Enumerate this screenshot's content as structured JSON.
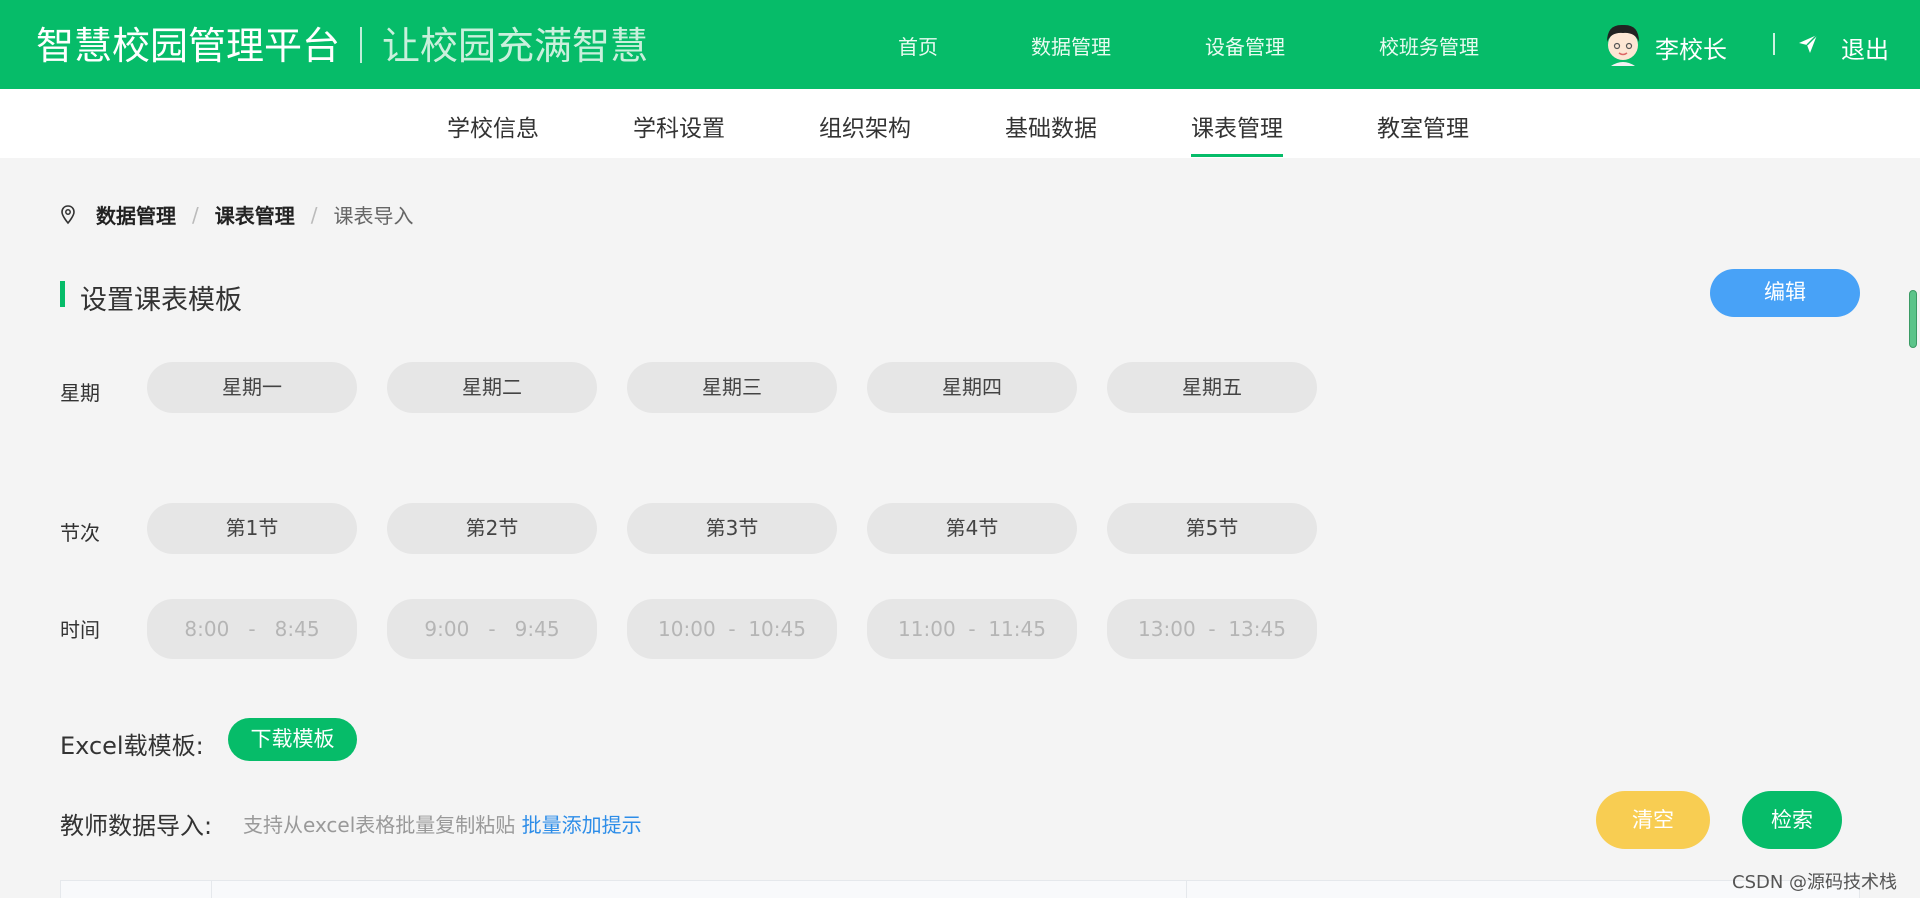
{
  "header": {
    "brand": "智慧校园管理平台",
    "slogan": "让校园充满智慧",
    "nav": [
      "首页",
      "数据管理",
      "设备管理",
      "校班务管理"
    ],
    "user_name": "李校长",
    "logout": "退出"
  },
  "subnav": {
    "items": [
      "学校信息",
      "学科设置",
      "组织架构",
      "基础数据",
      "课表管理",
      "教室管理"
    ],
    "active": "课表管理"
  },
  "breadcrumb": {
    "level1": "数据管理",
    "level2": "课表管理",
    "current": "课表导入",
    "separator": "/"
  },
  "section": {
    "title": "设置课表模板",
    "edit_label": "编辑"
  },
  "weekday_row": {
    "label": "星期",
    "values": [
      "星期一",
      "星期二",
      "星期三",
      "星期四",
      "星期五"
    ]
  },
  "period_row": {
    "label": "节次",
    "values": [
      "第1节",
      "第2节",
      "第3节",
      "第4节",
      "第5节"
    ]
  },
  "time_row": {
    "label": "时间",
    "values": [
      "8:00   -   8:45",
      "9:00   -   9:45",
      "10:00  -  10:45",
      "11:00  -  11:45",
      "13:00  -  13:45"
    ]
  },
  "excel": {
    "label": "Excel载模板:",
    "download_label": "下载模板"
  },
  "import": {
    "label": "教师数据导入:",
    "hint": "支持从excel表格批量复制粘贴",
    "link": "批量添加提示",
    "clear_label": "清空",
    "search_label": "检索"
  },
  "watermark": "CSDN @源码技术栈",
  "colors": {
    "primary": "#06bc69",
    "edit": "#48a2f7",
    "clear": "#f8cd52",
    "link": "#2d8de8"
  }
}
